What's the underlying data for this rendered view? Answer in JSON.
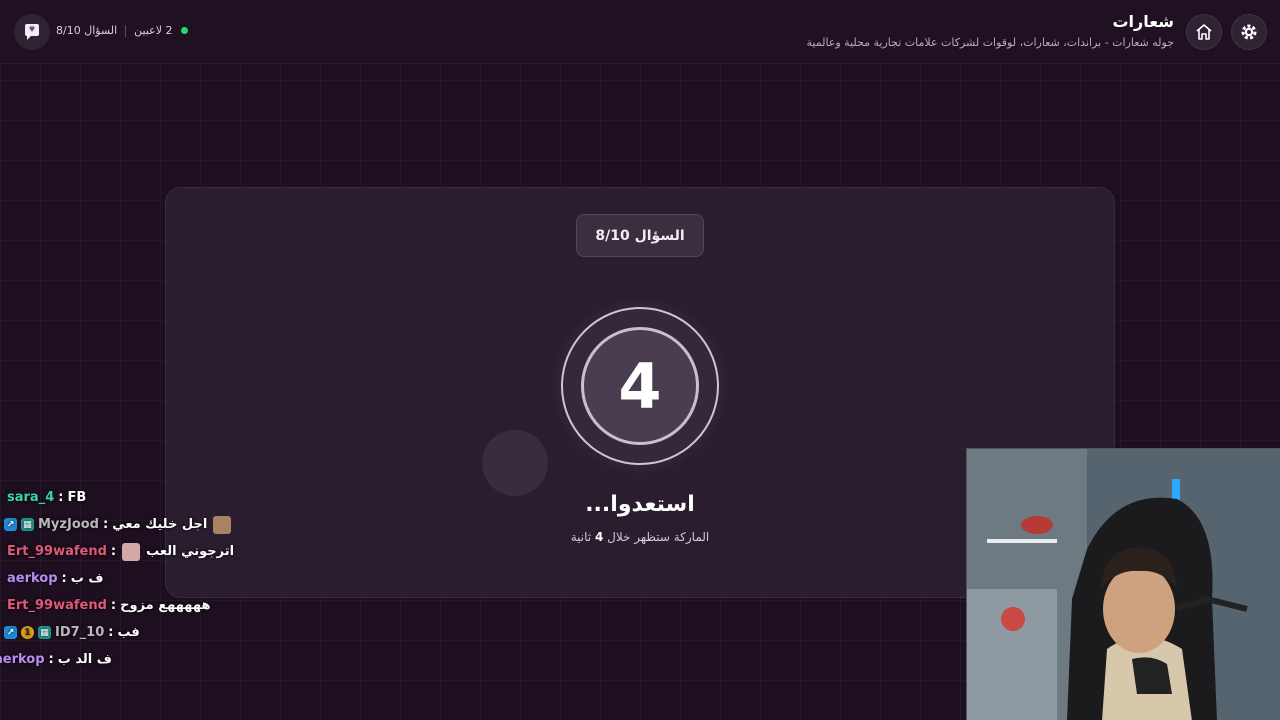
{
  "header": {
    "title": "شعارات",
    "subtitle": "جوله شعارات - براندات، شعارات، لوقوات لشركات علامات تجارية محلية وعالمية",
    "players_label": "2 لاعبين",
    "question_label": "السؤال 8/10"
  },
  "game": {
    "question_badge": "السؤال 8/10",
    "countdown": "4",
    "ready_text": "استعدوا...",
    "hint_before": "الماركة ستظهر خلال",
    "hint_number": "4",
    "hint_after": "ثانية"
  },
  "chat": [
    {
      "user": "sara_4",
      "message": "FB",
      "color": "#3ed3a4"
    },
    {
      "user": "MyzJood",
      "message": "اجل خليك معي",
      "color": "#b8b8b8"
    },
    {
      "user": "Ert_99wafend",
      "message": "اترجوني العب",
      "color": "#e05a78"
    },
    {
      "user": "aerkop",
      "message": "ف ب",
      "color": "#b98cf5"
    },
    {
      "user": "Ert_99wafend",
      "message": "هههههع مزوح",
      "color": "#e05a78"
    },
    {
      "user": "ID7_10",
      "message": "فب",
      "color": "#b8b8b8"
    },
    {
      "user": "aerkop",
      "message": "ف الد ب",
      "color": "#b98cf5"
    }
  ],
  "icons": {
    "settings": "gear-icon",
    "home": "home-icon",
    "logo": "chat-bubble-logo-icon",
    "online": "online-dot-icon"
  }
}
